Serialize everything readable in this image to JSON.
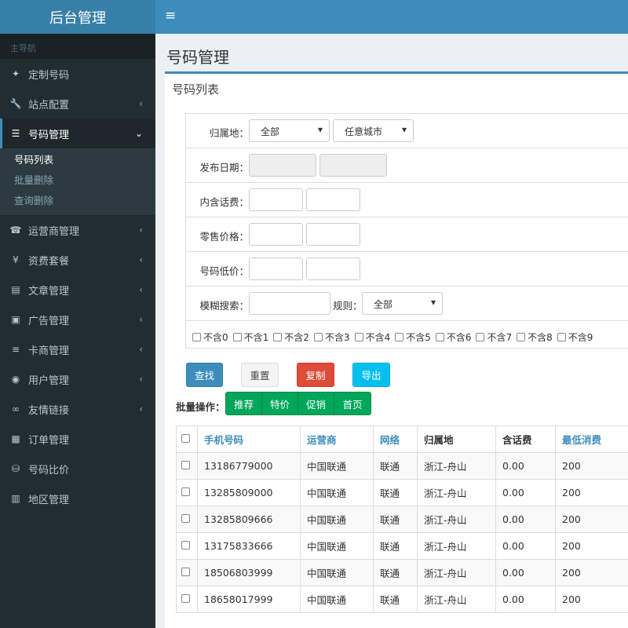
{
  "app": {
    "title": "后台管理"
  },
  "sidebar": {
    "header": "主导航",
    "items": [
      {
        "label": "定制号码",
        "icon": "pin-icon",
        "glyph": "✦",
        "chevron": false
      },
      {
        "label": "站点配置",
        "icon": "wrench-icon",
        "glyph": "🔧",
        "chevron": true
      },
      {
        "label": "号码管理",
        "icon": "list-icon",
        "glyph": "☰",
        "chevron": true,
        "active": true
      },
      {
        "label": "运营商管理",
        "icon": "phone-icon",
        "glyph": "☎",
        "chevron": true
      },
      {
        "label": "资费套餐",
        "icon": "yen-icon",
        "glyph": "¥",
        "chevron": true
      },
      {
        "label": "文章管理",
        "icon": "file-icon",
        "glyph": "▤",
        "chevron": true
      },
      {
        "label": "广告管理",
        "icon": "image-icon",
        "glyph": "▣",
        "chevron": true
      },
      {
        "label": "卡商管理",
        "icon": "list-ul-icon",
        "glyph": "≡",
        "chevron": true
      },
      {
        "label": "用户管理",
        "icon": "user-icon",
        "glyph": "◉",
        "chevron": true
      },
      {
        "label": "友情链接",
        "icon": "link-icon",
        "glyph": "∞",
        "chevron": true
      },
      {
        "label": "订单管理",
        "icon": "id-card-icon",
        "glyph": "▦",
        "chevron": false
      },
      {
        "label": "号码比价",
        "icon": "database-icon",
        "glyph": "⛁",
        "chevron": false
      },
      {
        "label": "地区管理",
        "icon": "clipboard-icon",
        "glyph": "▥",
        "chevron": false
      }
    ],
    "submenu": [
      "号码列表",
      "批量删除",
      "查询删除"
    ]
  },
  "page": {
    "title": "号码管理",
    "box_title": "号码列表"
  },
  "filter": {
    "region_label": "归属地：",
    "region_value": "全部",
    "city_value": "任意城市",
    "date_label": "发布日期：",
    "fee_label": "内含话费：",
    "price_label": "零售价格：",
    "low_label": "号码低价：",
    "fuzzy_label": "模糊搜索：",
    "rule_label": "规则：",
    "rule_value": "全部",
    "exclude": [
      "不含0",
      "不含1",
      "不含2",
      "不含3",
      "不含4",
      "不含5",
      "不含6",
      "不含7",
      "不含8",
      "不含9"
    ]
  },
  "buttons": {
    "search": "查找",
    "reset": "重置",
    "copy": "复制",
    "export": "导出"
  },
  "batch": {
    "label": "批量操作：",
    "actions": [
      "推荐",
      "特价",
      "促销",
      "首页"
    ]
  },
  "table": {
    "headers": [
      "手机号码",
      "运营商",
      "网络",
      "归属地",
      "含话费",
      "最低消费"
    ],
    "rows": [
      [
        "13186779000",
        "中国联通",
        "联通",
        "浙江-舟山",
        "0.00",
        "200"
      ],
      [
        "13285809000",
        "中国联通",
        "联通",
        "浙江-舟山",
        "0.00",
        "200"
      ],
      [
        "13285809666",
        "中国联通",
        "联通",
        "浙江-舟山",
        "0.00",
        "200"
      ],
      [
        "13175833666",
        "中国联通",
        "联通",
        "浙江-舟山",
        "0.00",
        "200"
      ],
      [
        "18506803999",
        "中国联通",
        "联通",
        "浙江-舟山",
        "0.00",
        "200"
      ],
      [
        "18658017999",
        "中国联通",
        "联通",
        "浙江-舟山",
        "0.00",
        "200"
      ]
    ]
  }
}
